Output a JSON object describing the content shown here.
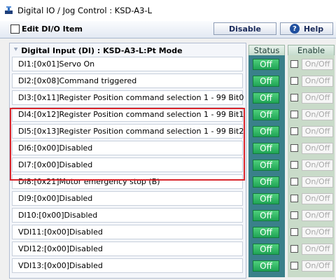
{
  "window": {
    "title": "Digital IO / Jog Control : KSD-A3-L"
  },
  "toolbar": {
    "edit_label": "Edit DI/O Item",
    "disable_label": "Disable",
    "help_label": "Help"
  },
  "panel": {
    "title": "Digital Input (DI) : KSD-A3-L:Pt Mode",
    "status_header": "Status",
    "enable_header": "Enable"
  },
  "rows": [
    {
      "label": "DI1:[0x01]Servo On",
      "status": "Off",
      "enable": "On/Off"
    },
    {
      "label": "DI2:[0x08]Command triggered",
      "status": "Off",
      "enable": "On/Off"
    },
    {
      "label": "DI3:[0x11]Register Position command selection 1 - 99 Bit0",
      "status": "Off",
      "enable": "On/Off"
    },
    {
      "label": "DI4:[0x12]Register Position command selection 1 - 99 Bit1",
      "status": "Off",
      "enable": "On/Off"
    },
    {
      "label": "DI5:[0x13]Register Position command selection 1 - 99 Bit2",
      "status": "Off",
      "enable": "On/Off"
    },
    {
      "label": "DI6:[0x00]Disabled",
      "status": "Off",
      "enable": "On/Off"
    },
    {
      "label": "DI7:[0x00]Disabled",
      "status": "Off",
      "enable": "On/Off"
    },
    {
      "label": "DI8:[0x21]Motor emergency stop (B)",
      "status": "Off",
      "enable": "On/Off"
    },
    {
      "label": "DI9:[0x00]Disabled",
      "status": "Off",
      "enable": "On/Off"
    },
    {
      "label": "DI10:[0x00]Disabled",
      "status": "Off",
      "enable": "On/Off"
    },
    {
      "label": "VDI11:[0x00]Disabled",
      "status": "Off",
      "enable": "On/Off"
    },
    {
      "label": "VDI12:[0x00]Disabled",
      "status": "Off",
      "enable": "On/Off"
    },
    {
      "label": "VDI13:[0x00]Disabled",
      "status": "Off",
      "enable": "On/Off"
    }
  ],
  "highlighted_rows": [
    "DI2",
    "DI3",
    "DI4",
    "DI5"
  ],
  "colors": {
    "status_on_green": "#1fa455",
    "status_column": "#3a808a",
    "enable_column": "#c9dbc9",
    "highlight_red": "#d9262c"
  },
  "icons": {
    "app": "app-icon",
    "help": "help-icon",
    "collapse": "chevron-down-icon"
  }
}
